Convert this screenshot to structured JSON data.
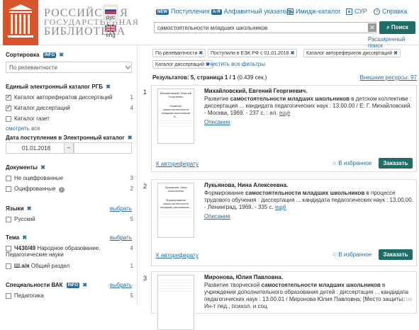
{
  "header": {
    "logo_line1": "РОССИЙСКАЯ",
    "logo_line2": "ГОСУДАРСТВЕННАЯ",
    "logo_line3": "БИБЛИОТЕКА",
    "emblem_text": "РОССИЙСКАЯ ГОСУДАРСТВЕННАЯ БИБЛИОТЕКА",
    "lang_ru": "рус",
    "lang_en": "eng",
    "nav": {
      "new_badge": "NEW",
      "arrivals": "Поступления",
      "alpha_badge": "А-Я",
      "alpha": "Алфавитный указатель",
      "image_catalog": "Имидж-каталог",
      "sur": "СУР",
      "help": "Справка"
    },
    "search_value": "самостоятельности младших школьников",
    "search_button": "Поиск",
    "advanced_search": "Расширенный поиск"
  },
  "sidebar": {
    "sort_title": "Сортировка",
    "info_badge": "INFO",
    "sort_value": "По релевантности",
    "ek_title": "Единый электронный каталог РГБ",
    "ek_items": [
      {
        "label": "Каталог авторефератов диссертаций",
        "count": "1",
        "checked": true
      },
      {
        "label": "Каталог диссертаций",
        "count": "4",
        "checked": true
      },
      {
        "label": "Каталог газет",
        "count": "",
        "checked": false
      }
    ],
    "see_all": "смотреть все",
    "date_title": "Дата поступления в Электронный каталог",
    "date_from": "01.01.2018",
    "date_sep": "–",
    "docs_title": "Документы",
    "docs_items": [
      {
        "label": "Не оцифрованные",
        "count": "3"
      },
      {
        "label": "Оцифрованные",
        "count": "2"
      }
    ],
    "lang_title": "Языки",
    "choose": "выбрать",
    "lang_items": [
      {
        "label": "Русский",
        "count": "5"
      }
    ],
    "topic_title": "Тема",
    "topic_items": [
      {
        "label": "Ч430/49 Народное образование. Педагогические науки",
        "code": "Ч430/49",
        "text": "Народное образование. Педагогические науки",
        "count": "4"
      },
      {
        "label": "Ш.а/я Общий раздел",
        "code": "Ш.а/я",
        "text": "Общий раздел",
        "count": "1"
      }
    ],
    "vak_title": "Специальности ВАК",
    "vak_items": [
      {
        "label": "Педагогика",
        "count": "5"
      }
    ]
  },
  "filters": {
    "chips": [
      "По релевантности",
      "Поступили в ЕЭК РФ с 01.01.2018",
      "Каталог авторефератов диссертаций",
      "Каталог диссертаций"
    ],
    "clear_all": "очистить все фильтры"
  },
  "results": {
    "summary": "Результатов: 5, страница 1 / 1",
    "time": "(0.439 сек.)",
    "external": "Внешние ресурсы: 97",
    "items": [
      {
        "num": "1",
        "author": "Михайловский, Евгений Георгиевич.",
        "pre": "Развитие ",
        "bold": "самостоятельности младших школьников",
        "post": " в детском коллективе : диссертация ... кандидата педагогических наук : 13.00.00 / Е. Г. Михайловский. - Москва, 1969. - 237 с. : ил.",
        "more": "ещё",
        "opis": "Описание",
        "ref": "К автореферату",
        "fav": "В избранное",
        "order": "Заказать",
        "thumb_author": "Михайловский, Евгений Георгиевич",
        "thumb_title": "Развитие самостоятельности младших школьников в..."
      },
      {
        "num": "2",
        "author": "Лукьянова, Нина Алексеевна.",
        "pre": "Формирование ",
        "bold": "самостоятельности младших школьников",
        "post": " в процессе трудового обучения : диссертация ... кандидата педагогических наук : 13.00.00. - Ленинград, 1969. - 335 с.",
        "more": "ещё",
        "opis": "Описание",
        "ref": "К автореферату",
        "fav": "В избранное",
        "order": "Заказать",
        "thumb_author": "Лукьянова, Нина Алексеевна",
        "thumb_title": "Формирование самостоятельности младших школьников..."
      },
      {
        "num": "3",
        "author": "Миронова, Юлия Павловна.",
        "pre": "Развитие творческой ",
        "bold": "самостоятельности младших школьников",
        "post": " в учреждении дополнительного образования детей : диссертация ... кандидата педагогических наук : 13.00.01 / Миронова Юлия Павловна; [Место защиты: Ин-т пед., психол. и соц.",
        "more": "",
        "opis": "",
        "ref": "",
        "fav": "",
        "order": "",
        "thumb_author": "",
        "thumb_title": ""
      }
    ]
  },
  "watermark": "Актив"
}
